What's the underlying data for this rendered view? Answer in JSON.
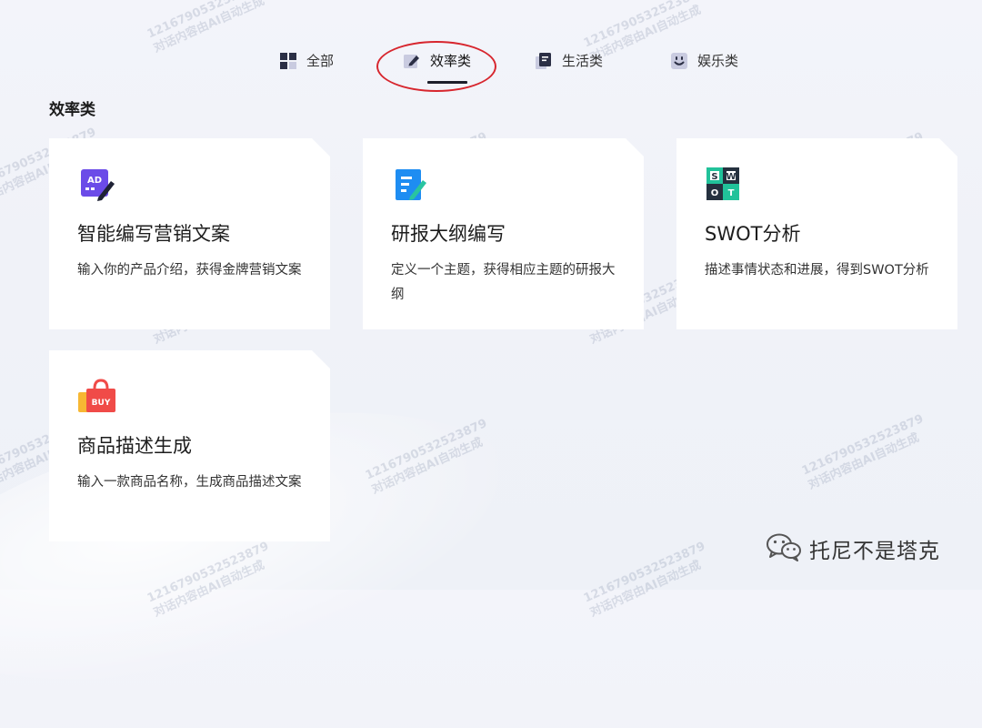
{
  "tabs": [
    {
      "label": "全部",
      "icon": "grid-icon"
    },
    {
      "label": "效率类",
      "icon": "pencil-icon",
      "active": true
    },
    {
      "label": "生活类",
      "icon": "notebook-icon"
    },
    {
      "label": "娱乐类",
      "icon": "smiley-icon"
    }
  ],
  "section": {
    "title": "效率类"
  },
  "cards": [
    {
      "title": "智能编写营销文案",
      "desc": "输入你的产品介绍，获得金牌营销文案",
      "icon": "ad-writing-icon",
      "icon_text": "AD"
    },
    {
      "title": "研报大纲编写",
      "desc": "定义一个主题，获得相应主题的研报大纲",
      "icon": "document-edit-icon"
    },
    {
      "title": "SWOT分析",
      "desc": "描述事情状态和进展，得到SWOT分析",
      "icon": "swot-icon",
      "icon_letters": [
        "S",
        "W",
        "O",
        "T"
      ]
    },
    {
      "title": "商品描述生成",
      "desc": "输入一款商品名称，生成商品描述文案",
      "icon": "shopping-bag-icon",
      "icon_text": "BUY"
    }
  ],
  "watermark": {
    "line1": "1216790532523879",
    "line2": "对话内容由AI自动生成"
  },
  "footer": {
    "wechat_label": "托尼不是塔克",
    "icon": "wechat-icon"
  },
  "colors": {
    "highlight": "#d7262e",
    "active_underline": "#1d1f2b",
    "ad_purple": "#6b4be8",
    "doc_blue": "#1e8df2",
    "swot_dark": "#25313f",
    "swot_teal": "#21c29a",
    "buy_red": "#f04b48",
    "buy_yellow": "#f7b733"
  }
}
